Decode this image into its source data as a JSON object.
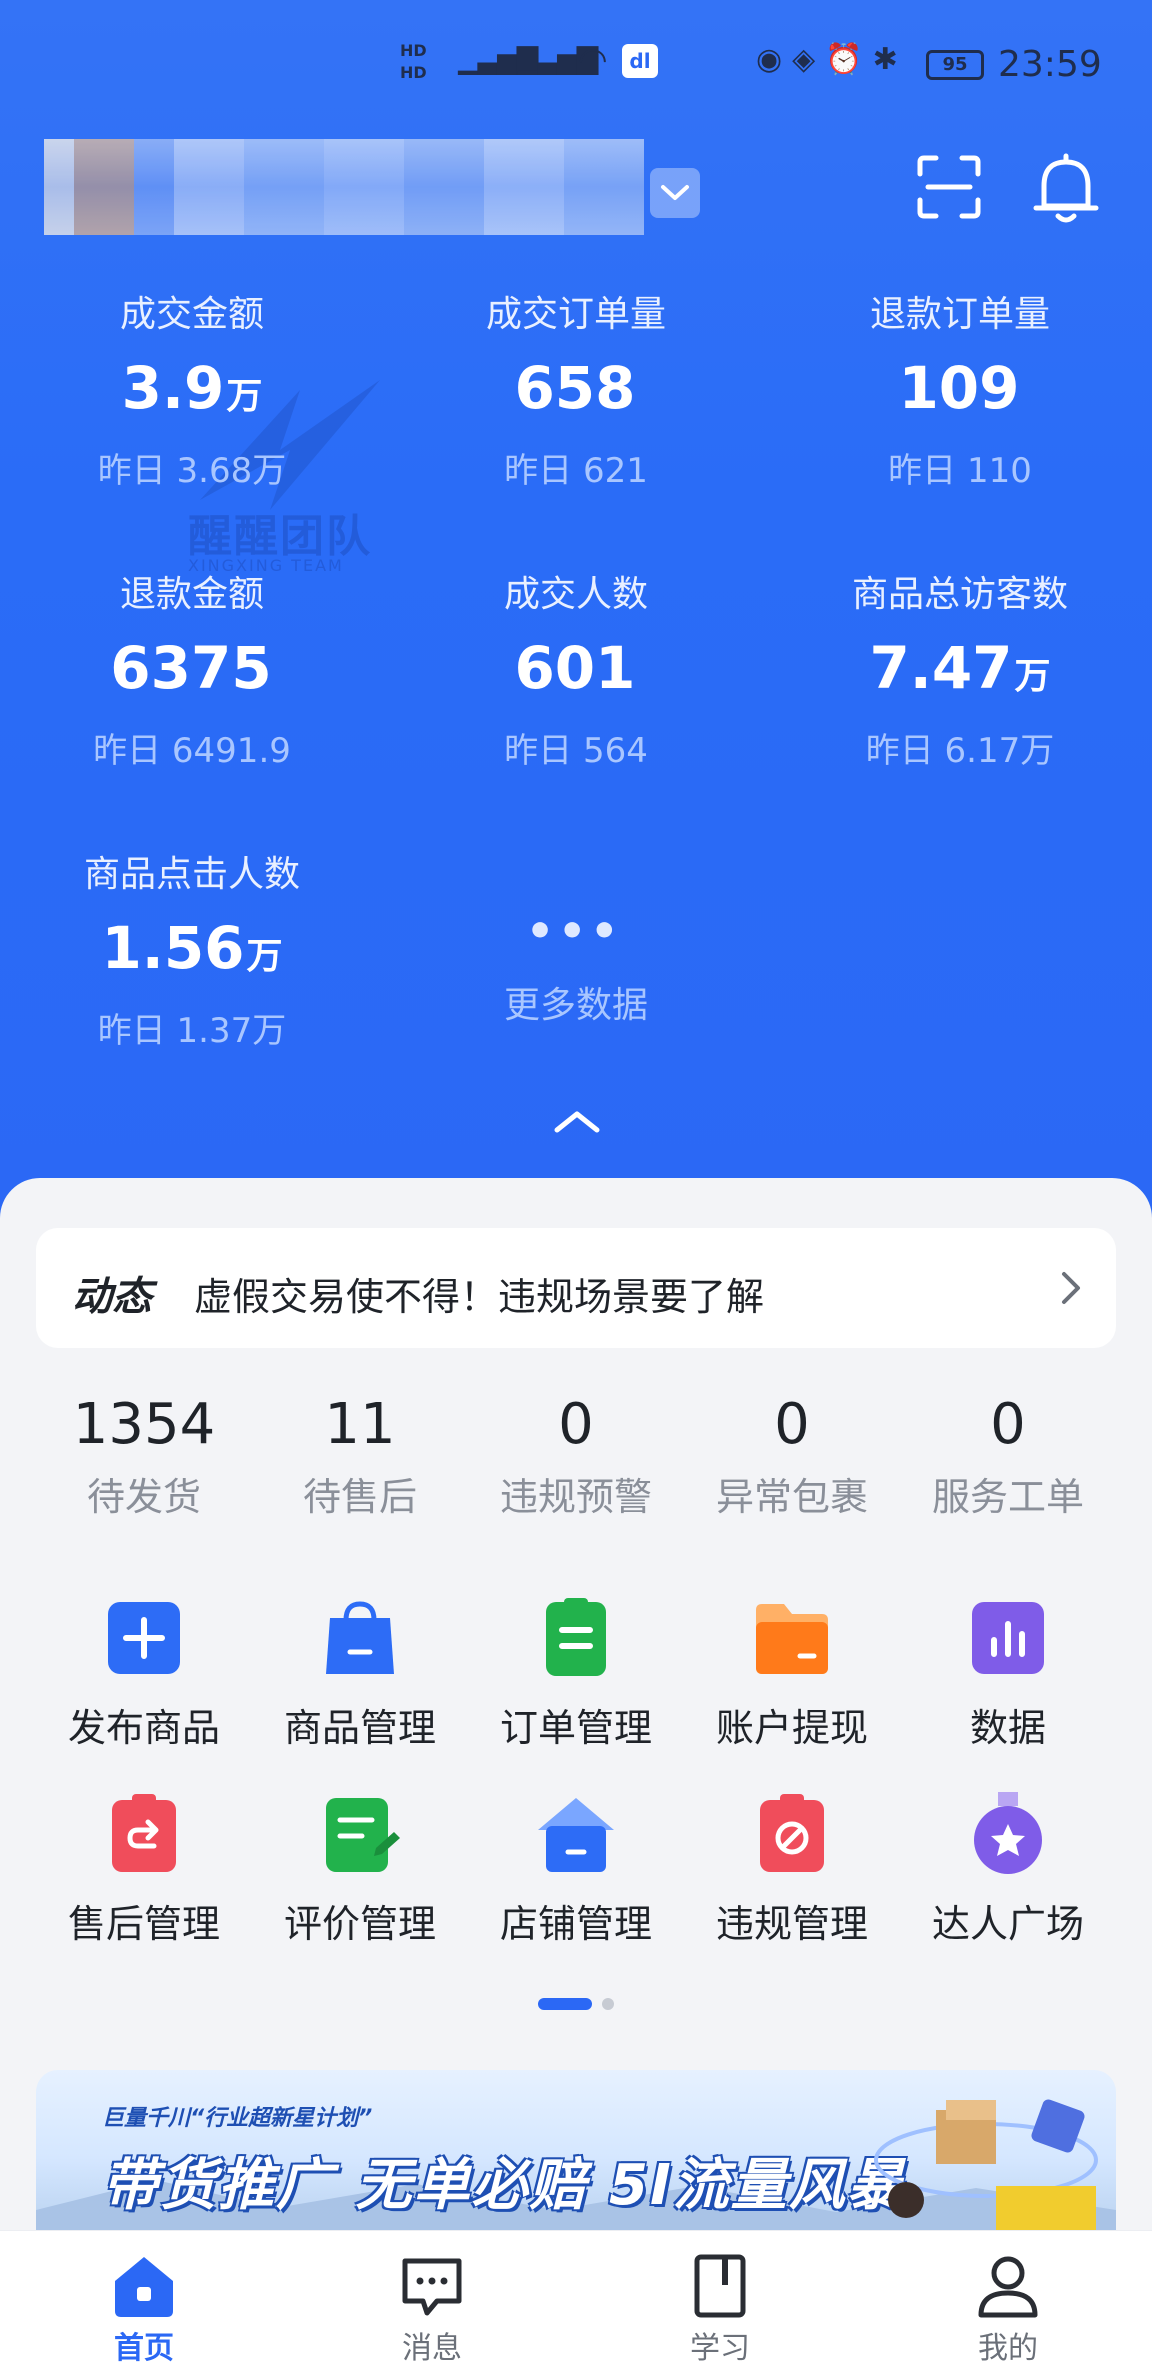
{
  "status_bar": {
    "hd": "HD",
    "network": "4G",
    "app_badge": "dl",
    "battery": "95",
    "time": "23:59"
  },
  "header": {
    "shop_name": "",
    "icons": [
      "chevron-down-icon",
      "scan-icon",
      "bell-icon"
    ]
  },
  "metrics": [
    {
      "label": "成交金额",
      "value": "3.9",
      "unit": "万",
      "yesterday": "昨日 3.68万"
    },
    {
      "label": "成交订单量",
      "value": "658",
      "unit": "",
      "yesterday": "昨日 621"
    },
    {
      "label": "退款订单量",
      "value": "109",
      "unit": "",
      "yesterday": "昨日 110"
    },
    {
      "label": "退款金额",
      "value": "6375",
      "unit": "",
      "yesterday": "昨日 6491.9"
    },
    {
      "label": "成交人数",
      "value": "601",
      "unit": "",
      "yesterday": "昨日 564"
    },
    {
      "label": "商品总访客数",
      "value": "7.47",
      "unit": "万",
      "yesterday": "昨日 6.17万"
    },
    {
      "label": "商品点击人数",
      "value": "1.56",
      "unit": "万",
      "yesterday": "昨日 1.37万"
    }
  ],
  "more": {
    "dots": "•••",
    "label": "更多数据"
  },
  "watermark": {
    "text": "醒醒团队",
    "sub": "XINGXING TEAM"
  },
  "news": {
    "tag": "动态",
    "text": "虚假交易使不得！违规场景要了解"
  },
  "counters": [
    {
      "value": "1354",
      "label": "待发货"
    },
    {
      "value": "11",
      "label": "待售后"
    },
    {
      "value": "0",
      "label": "违规预警"
    },
    {
      "value": "0",
      "label": "异常包裹"
    },
    {
      "value": "0",
      "label": "服务工单"
    }
  ],
  "shortcuts": [
    {
      "label": "发布商品",
      "icon": "plus-icon",
      "color": "#2d6cf6"
    },
    {
      "label": "商品管理",
      "icon": "shopping-bag-icon",
      "color": "#2d6cf6"
    },
    {
      "label": "订单管理",
      "icon": "order-clipboard-icon",
      "color": "#22b24c"
    },
    {
      "label": "账户提现",
      "icon": "wallet-folder-icon",
      "color": "#ff7a1a"
    },
    {
      "label": "数据",
      "icon": "bar-chart-icon",
      "color": "#7f5ce8"
    },
    {
      "label": "售后管理",
      "icon": "return-clipboard-icon",
      "color": "#f04d5b"
    },
    {
      "label": "评价管理",
      "icon": "review-pen-icon",
      "color": "#22b24c"
    },
    {
      "label": "店铺管理",
      "icon": "store-house-icon",
      "color": "#2d6cf6"
    },
    {
      "label": "违规管理",
      "icon": "forbidden-clipboard-icon",
      "color": "#f04d5b"
    },
    {
      "label": "达人广场",
      "icon": "star-medal-icon",
      "color": "#7f5ce8"
    }
  ],
  "pager": {
    "pages": 2,
    "current": 1
  },
  "banner": {
    "top": "巨量千川“行业超新星计划”",
    "main": "带货推广 无单必赔 5I流量风暴"
  },
  "tabs": [
    {
      "label": "首页",
      "icon": "home-icon",
      "active": true
    },
    {
      "label": "消息",
      "icon": "message-icon",
      "active": false
    },
    {
      "label": "学习",
      "icon": "book-icon",
      "active": false
    },
    {
      "label": "我的",
      "icon": "profile-icon",
      "active": false
    }
  ],
  "colors": {
    "brand_blue": "#2b68f5",
    "accent_green": "#22b24c",
    "accent_orange": "#ff7a1a",
    "accent_red": "#f04d5b",
    "accent_purple": "#7f5ce8"
  }
}
